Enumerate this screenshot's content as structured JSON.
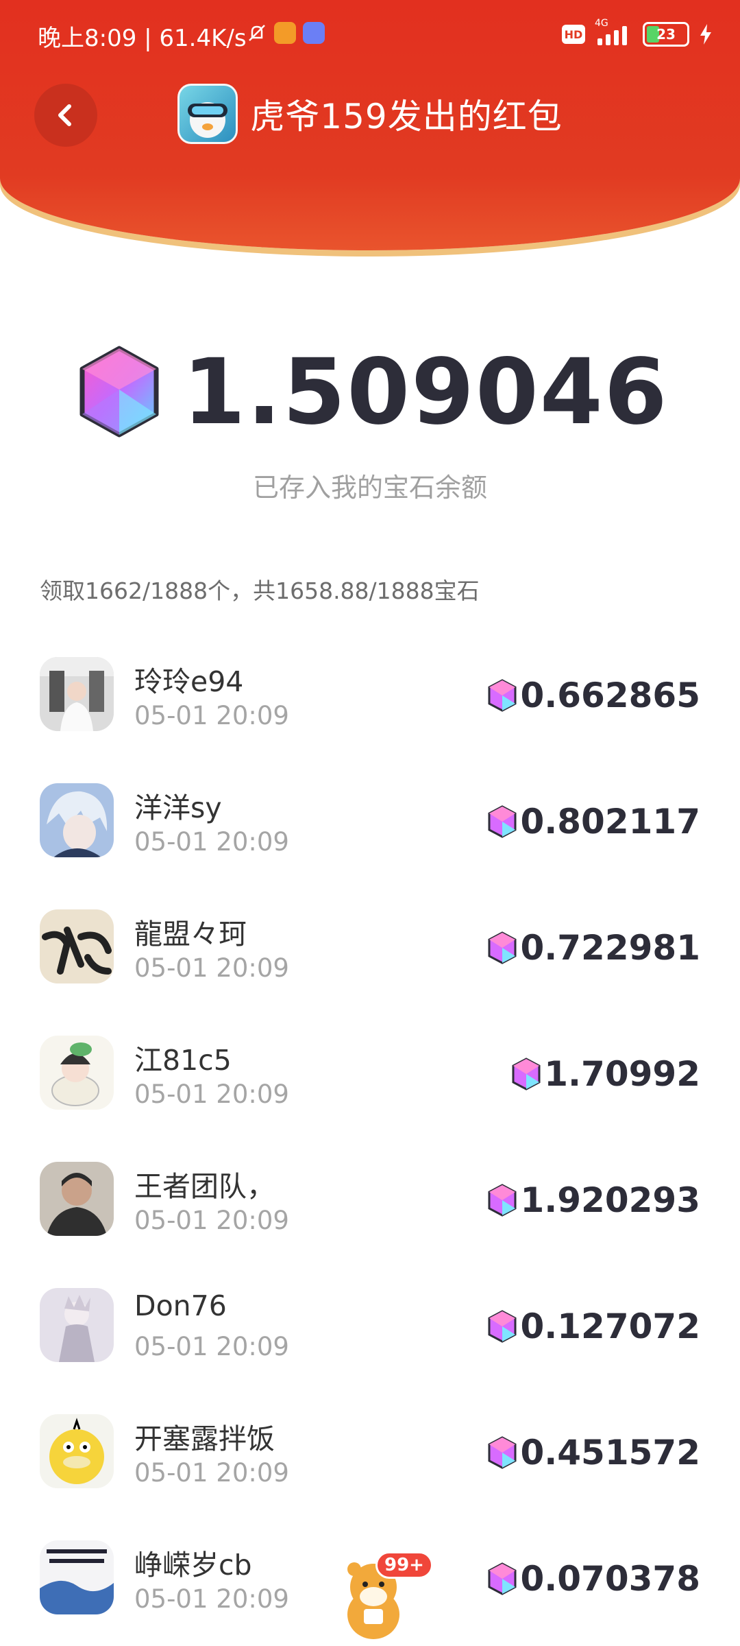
{
  "statusbar": {
    "time_speed": "晚上8:09 | 61.4K/s",
    "hd": "HD",
    "network": "4G",
    "battery": "23"
  },
  "header": {
    "title": "虎爷159发出的红包"
  },
  "amount": {
    "value": "1.509046",
    "note": "已存入我的宝石余额"
  },
  "summary": "领取1662/1888个，共1658.88/1888宝石",
  "records": [
    {
      "name": "玲玲e94",
      "time": "05-01 20:09",
      "amount": "0.662865",
      "avatar_color": "#d9d9d9"
    },
    {
      "name": "洋洋sy",
      "time": "05-01 20:09",
      "amount": "0.802117",
      "avatar_color": "#9fb7d8"
    },
    {
      "name": "龍盟々珂",
      "time": "05-01 20:09",
      "amount": "0.722981",
      "avatar_color": "#e9dfcc"
    },
    {
      "name": "江81c5",
      "time": "05-01 20:09",
      "amount": "1.70992",
      "avatar_color": "#f1efe4"
    },
    {
      "name": "王者团队，",
      "time": "05-01 20:09",
      "amount": "1.920293",
      "avatar_color": "#4a4a4a"
    },
    {
      "name": "Don76",
      "time": "05-01 20:09",
      "amount": "0.127072",
      "avatar_color": "#d8d3e3"
    },
    {
      "name": "开塞露拌饭",
      "time": "05-01 20:09",
      "amount": "0.451572",
      "avatar_color": "#f5d33d"
    },
    {
      "name": "峥嵘岁cb",
      "time": "05-01 20:09",
      "amount": "0.070378",
      "avatar_color": "#3f6fb8"
    }
  ],
  "floating_badge": "99+"
}
